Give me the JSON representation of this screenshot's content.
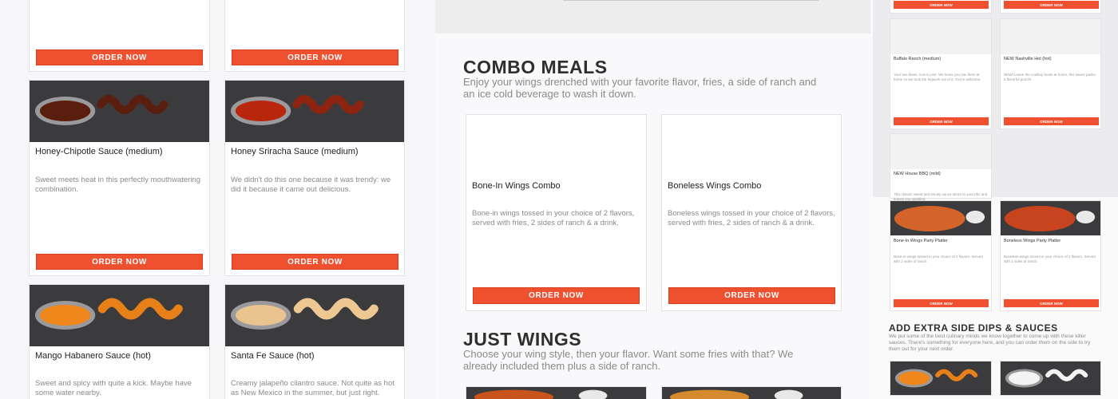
{
  "order_label": "ORDER NOW",
  "left_sauces": [
    {
      "title": "Honey-Chipotle Sauce (medium)",
      "desc": "Sweet meets heat in this perfectly mouthwatering combination."
    },
    {
      "title": "Honey Sriracha Sauce (medium)",
      "desc": "We didn't do this one because it was trendy: we did it because it came out delicious."
    },
    {
      "title": "Mango Habanero Sauce (hot)",
      "desc": "Sweet and spicy with quite a kick. Maybe have some water nearby."
    },
    {
      "title": "Santa Fe Sauce (hot)",
      "desc": "Creamy jalapeño cilantro sauce. Not quite as hot as New Mexico in the summer, but just right."
    }
  ],
  "combo": {
    "heading": "COMBO MEALS",
    "intro": "Enjoy your wings drenched with your favorite flavor, fries, a side of ranch and an ice cold beverage to wash it down.",
    "items": [
      {
        "title": "Bone-In Wings Combo",
        "desc": "Bone-in wings tossed in your choice of 2 flavors, served with fries, 2 sides of ranch & a drink."
      },
      {
        "title": "Boneless Wings Combo",
        "desc": "Boneless wings tossed in your choice of 2 flavors, served with fries, 2 sides of ranch & a drink."
      }
    ]
  },
  "just_wings": {
    "heading": "JUST WINGS",
    "intro": "Choose your wing style, then your flavor. Want some fries with that? We already included them plus a side of ranch."
  },
  "right": {
    "sauces": [
      {
        "title": "Buffalo Ranch (medium)",
        "desc": "Your two faves, now in one. We know you mix them at home so we took the legwork out of it. You're welcome."
      },
      {
        "title": "NEW Nashville Hot (hot)",
        "desc": "NEW! Leave the cowboy boots at home, this sauce packs a flavorful punch!"
      },
      {
        "title": "NEW House BBQ (mild)",
        "desc": "This classic sweet and smoky sauce sticks to your ribs and leaves you satisfied."
      }
    ],
    "platters": [
      {
        "title": "Bone-In Wings Party Platter",
        "desc": "Bone-in wings tossed in your choice of 2 flavors. Served with 2 sides of ranch."
      },
      {
        "title": "Boneless Wings Party Platter",
        "desc": "Boneless wings tossed in your choice of 2 flavors. Served with 2 sides of ranch."
      }
    ],
    "extra_heading": "ADD EXTRA SIDE DIPS & SAUCES",
    "extra_intro": "We put some of the best culinary minds we know together to come up with these killer sauces. There's something for everyone here, and you can order them on the side to try them out for your next order."
  },
  "colors": {
    "accent": "#ef5030",
    "photo_bg": "#3a3a3c"
  }
}
